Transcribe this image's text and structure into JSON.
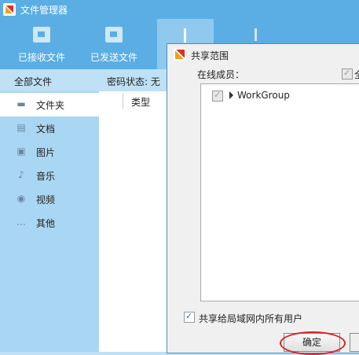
{
  "window": {
    "title": "文件管理器"
  },
  "toolbar": {
    "received": "已接收文件",
    "sent": "已发送文件",
    "upload": "",
    "download": ""
  },
  "sidebar": {
    "header": "全部文件",
    "items": [
      {
        "label": "文件夹",
        "icon": "folder-icon"
      },
      {
        "label": "文档",
        "icon": "document-icon"
      },
      {
        "label": "图片",
        "icon": "image-icon"
      },
      {
        "label": "音乐",
        "icon": "music-icon"
      },
      {
        "label": "视频",
        "icon": "video-icon"
      },
      {
        "label": "其他",
        "icon": "more-icon"
      }
    ]
  },
  "content": {
    "password_status": "密码状态: 无",
    "column_type": "类型"
  },
  "dialog": {
    "title": "共享范围",
    "online_members_label": "在线成员：",
    "select_all_label": "全",
    "group_name": "WorkGroup",
    "share_all_label": "共享给局域网内所有用户",
    "ok_label": "确定"
  },
  "colors": {
    "toolbar": "#5aaee4",
    "sidebar": "#a9d6f2",
    "highlight": "#dd2222"
  }
}
